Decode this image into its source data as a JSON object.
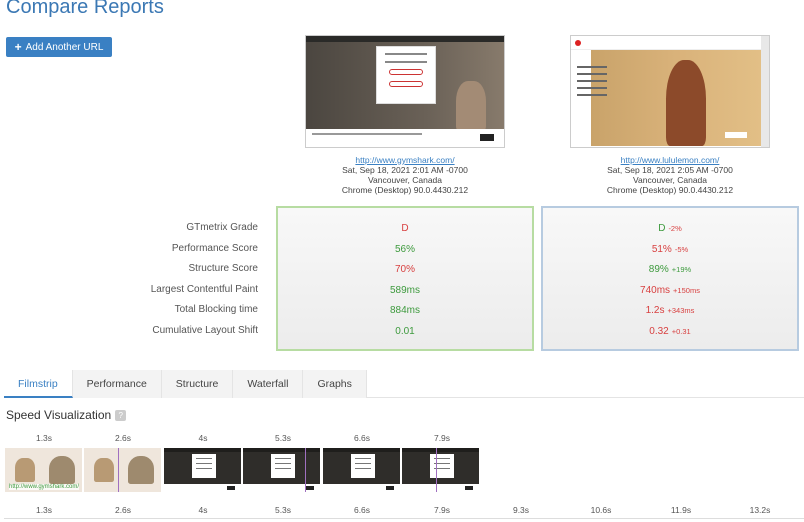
{
  "page": {
    "title": "Compare Reports"
  },
  "toolbar": {
    "add_url_label": "Add Another URL"
  },
  "reports": [
    {
      "url": "http://www.gymshark.com/",
      "date": "Sat, Sep 18, 2021 2:01 AM -0700",
      "location": "Vancouver, Canada",
      "browser": "Chrome (Desktop) 90.0.4430.212"
    },
    {
      "url": "http://www.lululemon.com/",
      "date": "Sat, Sep 18, 2021 2:05 AM -0700",
      "location": "Vancouver, Canada",
      "browser": "Chrome (Desktop) 90.0.4430.212"
    }
  ],
  "metrics": {
    "labels": [
      "GTmetrix Grade",
      "Performance Score",
      "Structure Score",
      "Largest Contentful Paint",
      "Total Blocking time",
      "Cumulative Layout Shift"
    ],
    "report1": [
      {
        "value": "D",
        "color": "#d84040"
      },
      {
        "value": "56%",
        "color": "#3d9a3d"
      },
      {
        "value": "70%",
        "color": "#d84040"
      },
      {
        "value": "589ms",
        "color": "#3d9a3d"
      },
      {
        "value": "884ms",
        "color": "#3d9a3d"
      },
      {
        "value": "0.01",
        "color": "#3d9a3d"
      }
    ],
    "report2": [
      {
        "value": "D",
        "delta": "-2%",
        "color": "#3d9a3d"
      },
      {
        "value": "51%",
        "delta": "-5%",
        "color": "#d84040"
      },
      {
        "value": "89%",
        "delta": "+19%",
        "color": "#3d9a3d"
      },
      {
        "value": "740ms",
        "delta": "+150ms",
        "color": "#d84040"
      },
      {
        "value": "1.2s",
        "delta": "+343ms",
        "color": "#d84040"
      },
      {
        "value": "0.32",
        "delta": "+0.31",
        "color": "#d84040"
      }
    ]
  },
  "tabs": [
    {
      "label": "Filmstrip",
      "active": true
    },
    {
      "label": "Performance",
      "active": false
    },
    {
      "label": "Structure",
      "active": false
    },
    {
      "label": "Waterfall",
      "active": false
    },
    {
      "label": "Graphs",
      "active": false
    }
  ],
  "speed_visualization": {
    "title": "Speed Visualization",
    "help": "?",
    "top_ticks": [
      "1.3s",
      "2.6s",
      "4s",
      "5.3s",
      "6.6s",
      "7.9s"
    ],
    "bottom_ticks": [
      "1.3s",
      "2.6s",
      "4s",
      "5.3s",
      "6.6s",
      "7.9s",
      "9.3s",
      "10.6s",
      "11.9s",
      "13.2s"
    ],
    "frame_caption": "http://www.gymshark.com/"
  },
  "colors": {
    "accent": "#3a80c3",
    "good": "#3d9a3d",
    "bad": "#d84040",
    "box1_border": "#b7dca2",
    "box2_border": "#b7cbe0"
  }
}
